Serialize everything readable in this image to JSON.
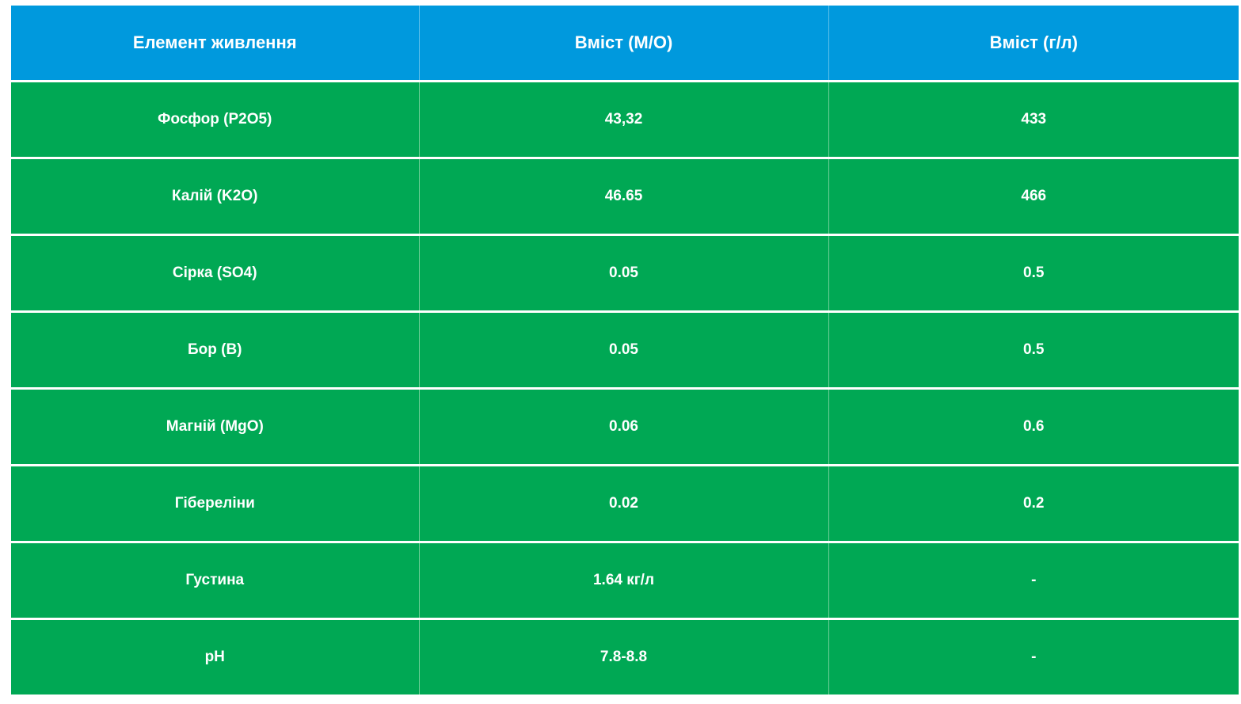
{
  "table": {
    "headers": [
      "Елемент живлення",
      "Вміст (М/О)",
      "Вміст (г/л)"
    ],
    "rows": [
      [
        "Фосфор (P2O5)",
        "43,32",
        "433"
      ],
      [
        "Калій (K2O)",
        "46.65",
        "466"
      ],
      [
        "Сірка (SO4)",
        "0.05",
        "0.5"
      ],
      [
        "Бор (B)",
        "0.05",
        "0.5"
      ],
      [
        "Магній (MgO)",
        "0.06",
        "0.6"
      ],
      [
        "Гібереліни",
        "0.02",
        "0.2"
      ],
      [
        "Густина",
        "1.64 кг/л",
        "-"
      ],
      [
        "pH",
        "7.8-8.8",
        "-"
      ]
    ]
  },
  "colors": {
    "header_bg": "#0099dd",
    "row_bg": "#00a854",
    "text": "#ffffff"
  }
}
